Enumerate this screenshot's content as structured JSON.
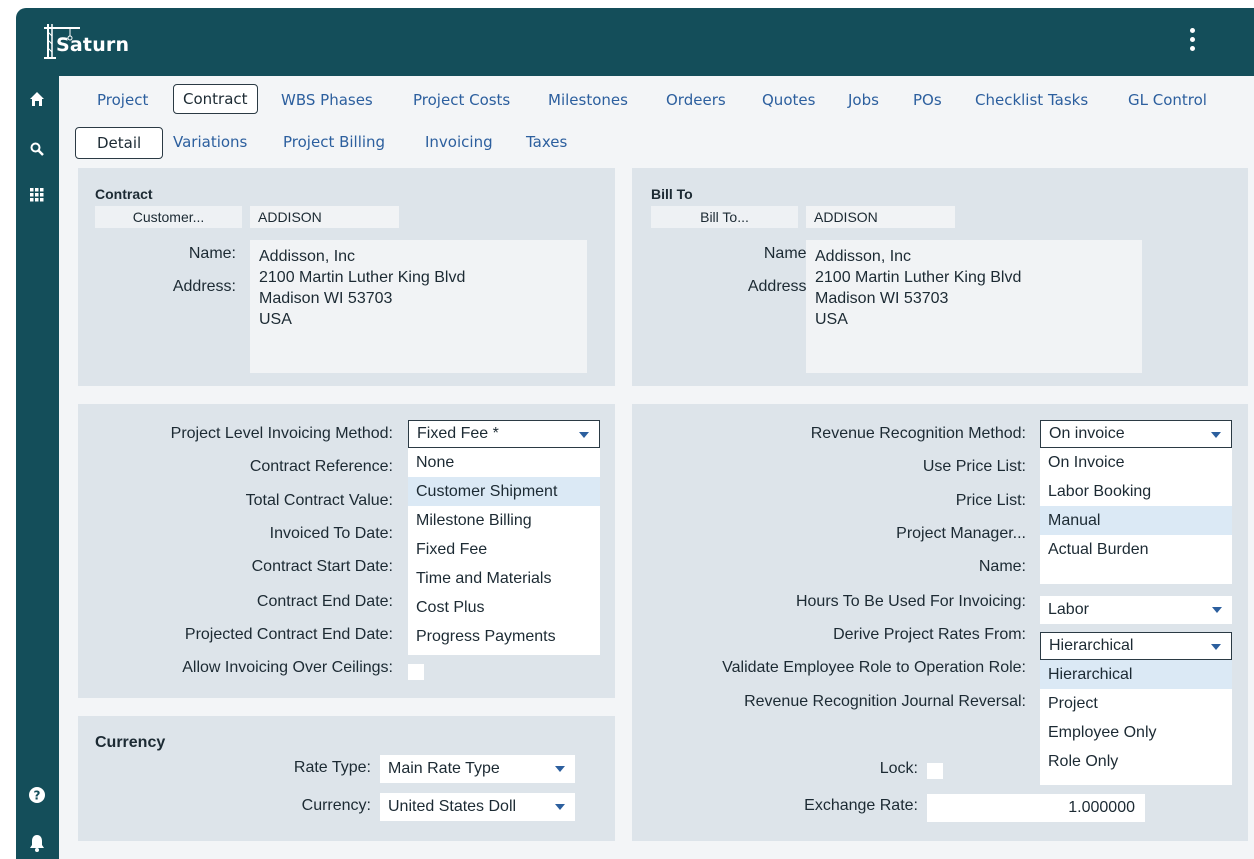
{
  "app": {
    "title": "Saturn"
  },
  "nav_tabs": [
    "Project",
    "Contract",
    "WBS Phases",
    "Project Costs",
    "Milestones",
    "Ordeers",
    "Quotes",
    "Jobs",
    "POs",
    "Checklist Tasks",
    "GL Control"
  ],
  "sub_tabs": [
    "Detail",
    "Variations",
    "Project Billing",
    "Invoicing",
    "Taxes"
  ],
  "contract": {
    "title": "Contract",
    "customer_button": "Customer...",
    "customer_code": "ADDISON",
    "name_label": "Name:",
    "address_label": "Address:",
    "address_lines": [
      "Addisson, Inc",
      "2100 Martin Luther King Blvd",
      "Madison WI 53703",
      "USA"
    ]
  },
  "bill_to": {
    "title": "Bill To",
    "button": "Bill To...",
    "code": "ADDISON",
    "name_label": "Name:",
    "address_label": "Address:",
    "address_lines": [
      "Addisson, Inc",
      "2100 Martin Luther King Blvd",
      "Madison WI 53703",
      "USA"
    ]
  },
  "invoicing": {
    "method_label": "Project Level Invoicing Method:",
    "method_value": "Fixed Fee *",
    "method_options": [
      "None",
      "Customer Shipment",
      "Milestone Billing",
      "Fixed Fee",
      "Time and Materials",
      "Cost Plus",
      "Progress Payments"
    ],
    "labels": [
      "Contract Reference:",
      "Total Contract Value:",
      "Invoiced To Date:",
      "Contract Start Date:",
      "Contract End Date:",
      "Projected Contract End Date:",
      "Allow Invoicing Over Ceilings:"
    ]
  },
  "currency": {
    "title": "Currency",
    "rate_type_label": "Rate Type:",
    "rate_type_value": "Main Rate Type",
    "currency_label": "Currency:",
    "currency_value": "United States Doll"
  },
  "revenue": {
    "method_label": "Revenue Recognition Method:",
    "method_value": "On invoice",
    "method_options": [
      "On Invoice",
      "Labor Booking",
      "Manual",
      "Actual Burden"
    ],
    "labels": [
      "Use Price List:",
      "Price List:",
      "Project Manager...",
      "Name:"
    ],
    "hours_label": "Hours To Be Used For Invoicing:",
    "hours_value": "Labor",
    "derive_label": "Derive Project Rates From:",
    "derive_value": "Hierarchical",
    "derive_options": [
      "Hierarchical",
      "Project",
      "Employee Only",
      "Role Only"
    ],
    "validate_label": "Validate Employee Role to Operation Role:",
    "reversal_label": "Revenue Recognition Journal Reversal:",
    "lock_label": "Lock:",
    "exchange_label": "Exchange Rate:",
    "exchange_value": "1.000000"
  },
  "colors": {
    "header": "#144e5a",
    "link": "#2c5f9e",
    "panel": "#dde4ea",
    "highlight": "#dbe9f5"
  }
}
